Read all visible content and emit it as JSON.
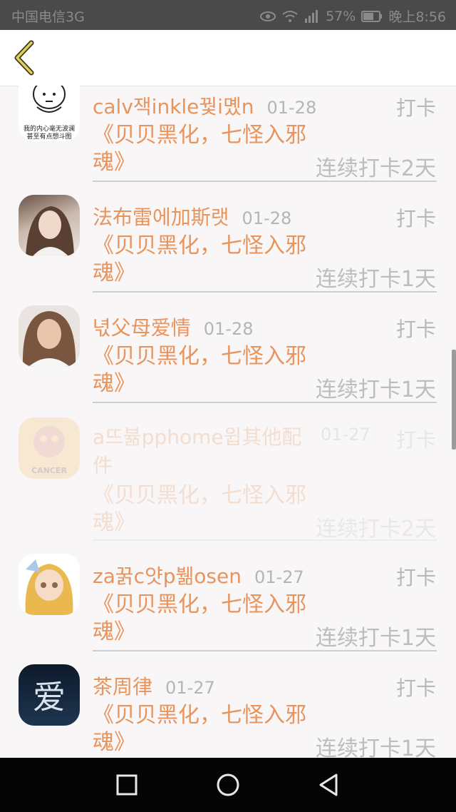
{
  "status_bar": {
    "carrier": "中国电信3G",
    "battery": "57%",
    "time": "晚上8:56",
    "icons": [
      "eye-icon",
      "wifi-icon",
      "signal-icon",
      "battery-icon"
    ]
  },
  "app_bar": {
    "back_icon": "chevron-left-icon"
  },
  "list": {
    "items": [
      {
        "name": "calv잭inkle꿫i몠n",
        "date": "01-28",
        "badge": "打卡",
        "book": "《贝贝黑化，七怪入邪魂》",
        "streak": "连续打卡2天",
        "avatar_text": "我的内心毫无波澜\n甚至有点想斗图"
      },
      {
        "name": "法布雷에加斯랫",
        "date": "01-28",
        "badge": "打卡",
        "book": "《贝贝黑化，七怪入邪魂》",
        "streak": "连续打卡1天",
        "avatar_text": ""
      },
      {
        "name": "녃父母爱情",
        "date": "01-28",
        "badge": "打卡",
        "book": "《贝贝黑化，七怪入邪魂》",
        "streak": "连续打卡1天",
        "avatar_text": ""
      },
      {
        "name": "a뜨뷺pphome윕其他配件",
        "date": "01-27",
        "badge": "打卡",
        "book": "《贝贝黑化，七怪入邪魂》",
        "streak": "连续打卡2天",
        "avatar_text": "CANCER"
      },
      {
        "name": "za꿁c얏p뷂osen",
        "date": "01-27",
        "badge": "打卡",
        "book": "《贝贝黑化，七怪入邪魂》",
        "streak": "连续打卡1天",
        "avatar_text": ""
      },
      {
        "name": "茶周律",
        "date": "01-27",
        "badge": "打卡",
        "book": "《贝贝黑化，七怪入邪魂》",
        "streak": "连续打卡1天",
        "avatar_text": "爱"
      }
    ]
  },
  "nav_bar": {
    "icons": [
      "square-recents-icon",
      "circle-home-icon",
      "triangle-back-icon"
    ]
  },
  "colors": {
    "accent": "#e8945d",
    "muted": "#b8b8b8",
    "back_icon": "#d9c44a"
  }
}
